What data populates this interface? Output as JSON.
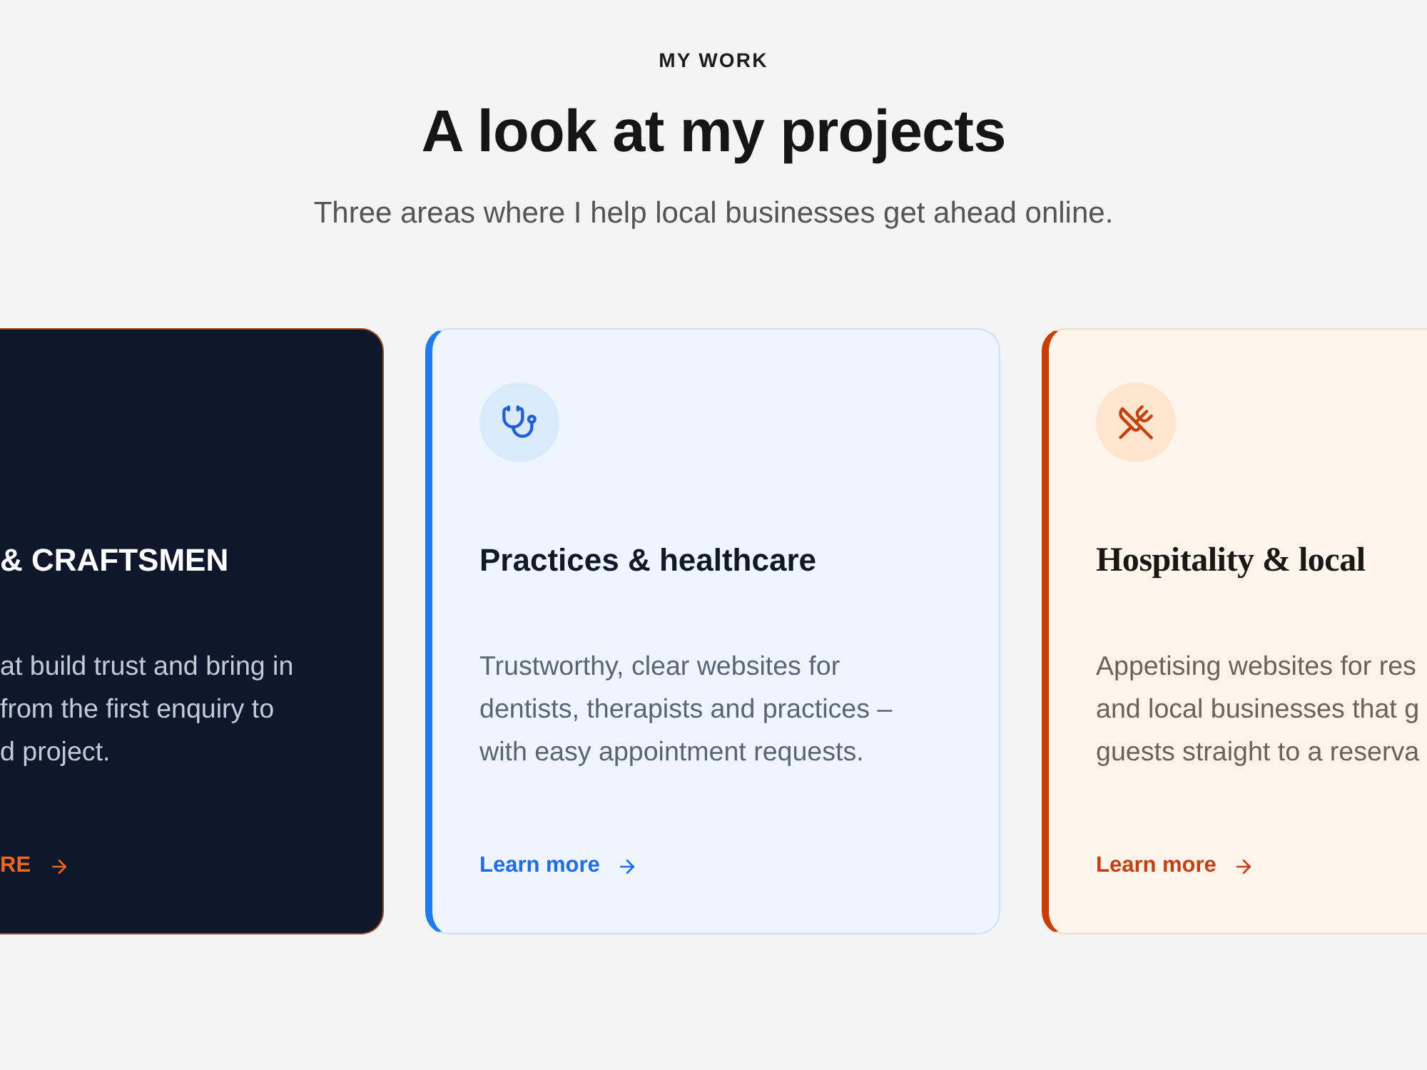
{
  "section": {
    "eyebrow": "MY WORK",
    "heading": "A look at my projects",
    "subheading": "Three areas where I help local businesses get ahead online."
  },
  "cards": [
    {
      "kind": "dark",
      "title": "& CRAFTSMEN",
      "description_lines": [
        "at build trust and bring in",
        "from the first enquiry to",
        "d project."
      ],
      "link": "RE"
    },
    {
      "kind": "light",
      "title": "Practices & healthcare",
      "description_lines": [
        "Trustworthy, clear websites for",
        "dentists, therapists and practices –",
        "with easy appointment requests."
      ],
      "link": "Learn more"
    },
    {
      "kind": "warm",
      "title": "Hospitality & local",
      "description_lines": [
        "Appetising websites for res",
        "and local businesses that g",
        "guests straight to a reserva"
      ],
      "link": "Learn more"
    }
  ]
}
